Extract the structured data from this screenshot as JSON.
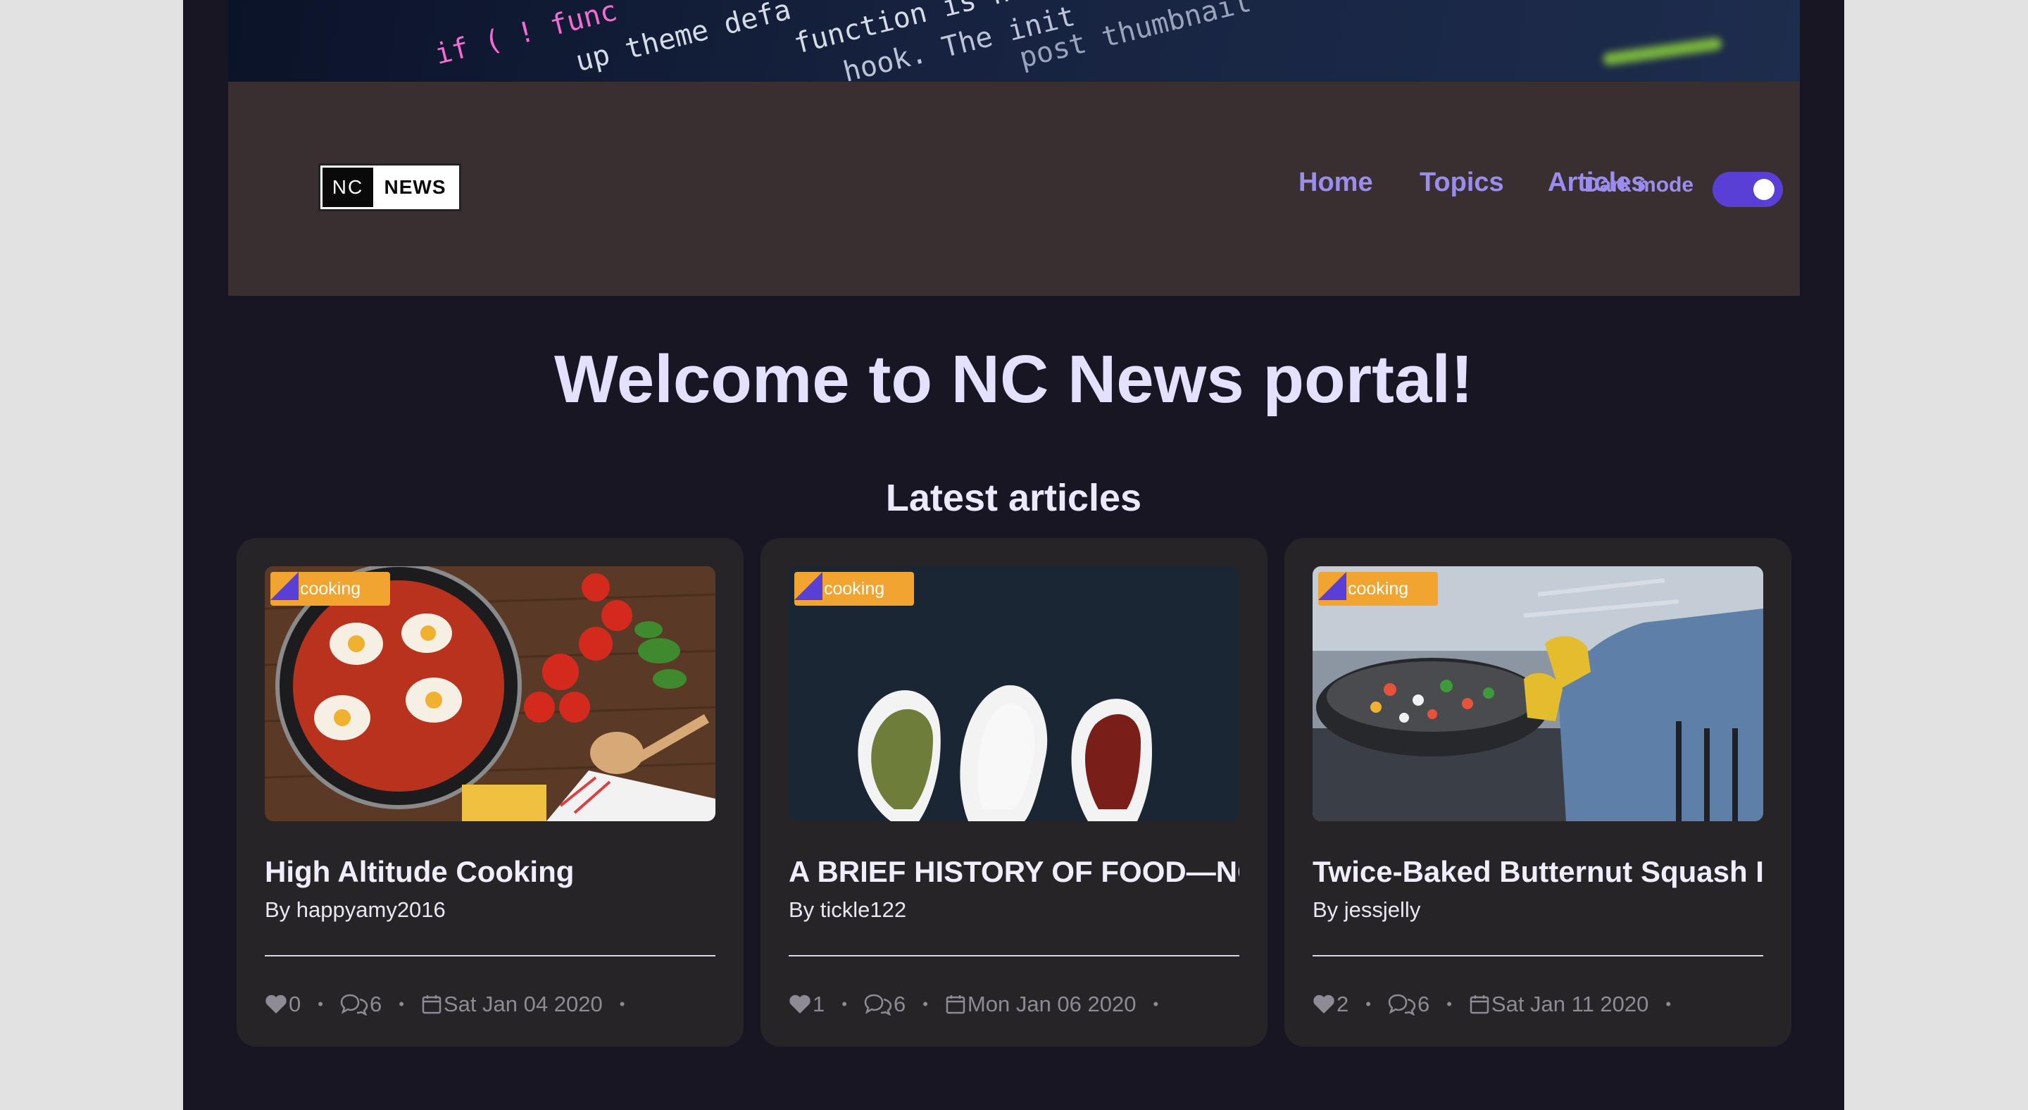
{
  "header": {
    "logo": {
      "left": "NC",
      "right": "NEWS"
    },
    "nav": [
      "Home",
      "Topics",
      "Articles"
    ],
    "dark_mode_label": "Dark mode",
    "dark_mode_on": true
  },
  "hero_code": {
    "lines": [
      "if ( ! func",
      "up theme defa",
      "function is ho",
      "hook. The init",
      "post thumbnail"
    ]
  },
  "main": {
    "welcome": "Welcome to NC News portal!",
    "latest_heading": "Latest articles"
  },
  "articles": [
    {
      "topic": "cooking",
      "title": "High Altitude Cooking",
      "author": "By happyamy2016",
      "votes": "0",
      "comments": "6",
      "date": "Sat Jan 04 2020",
      "image": "shakshuka-pan-icon"
    },
    {
      "topic": "cooking",
      "title": "A BRIEF HISTORY OF FOOD—NO BIG DEAL",
      "author": "By tickle122",
      "votes": "1",
      "comments": "6",
      "date": "Mon Jan 06 2020",
      "image": "spice-spoons-icon"
    },
    {
      "topic": "cooking",
      "title": "Twice-Baked Butternut Squash Is the Thanksgiving Side Dish of Your Dreams",
      "author": "By jessjelly",
      "votes": "2",
      "comments": "6",
      "date": "Sat Jan 11 2020",
      "image": "wok-cooking-icon"
    }
  ],
  "colors": {
    "page_bg": "#171622",
    "navbar_bg": "#3a2f30",
    "accent": "#9b8df0",
    "toggle": "#5a3fd6",
    "tag": "#f2a431",
    "card_bg": "#272428"
  }
}
